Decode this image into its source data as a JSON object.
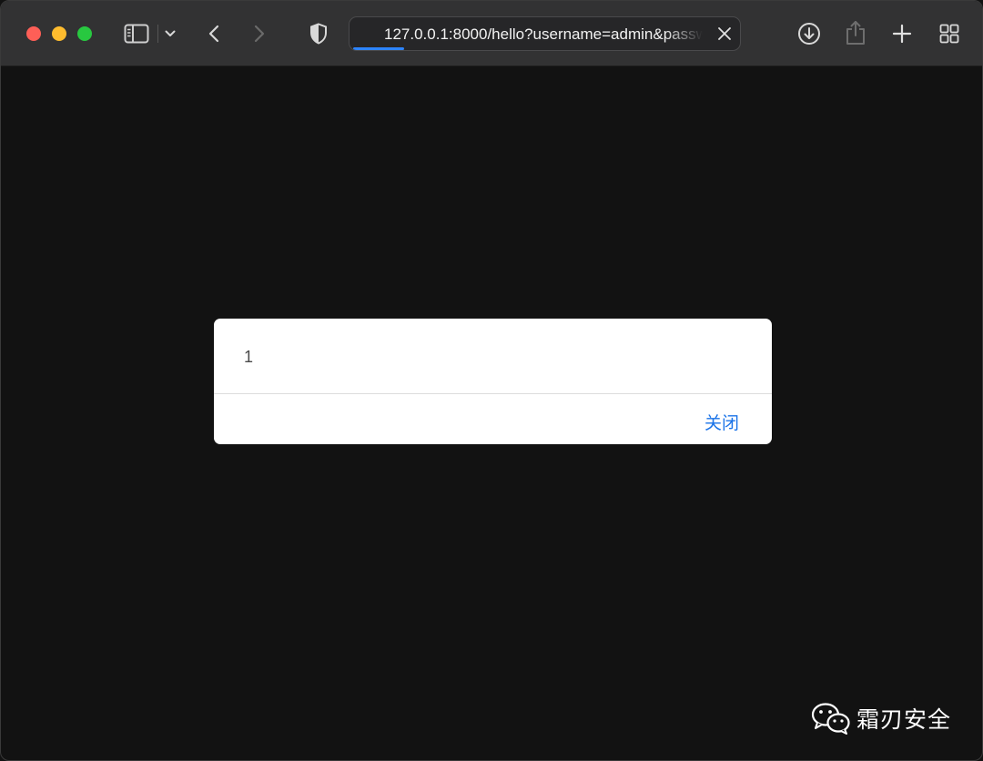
{
  "browser": {
    "url": "127.0.0.1:8000/hello?username=admin&password=admin",
    "icons": [
      "sidebar-icon",
      "chevron-down-icon",
      "back-icon",
      "forward-icon",
      "shield-icon",
      "close-icon",
      "download-icon",
      "share-icon",
      "plus-icon",
      "tab-overview-icon"
    ]
  },
  "dialog": {
    "message": "1",
    "close_label": "关闭"
  },
  "watermark": {
    "text": "霜刃安全"
  },
  "colors": {
    "toolbar": "#323233",
    "page_background": "#121212",
    "dialog_button": "#1a73e8",
    "load_progress": "#2d84ff"
  }
}
